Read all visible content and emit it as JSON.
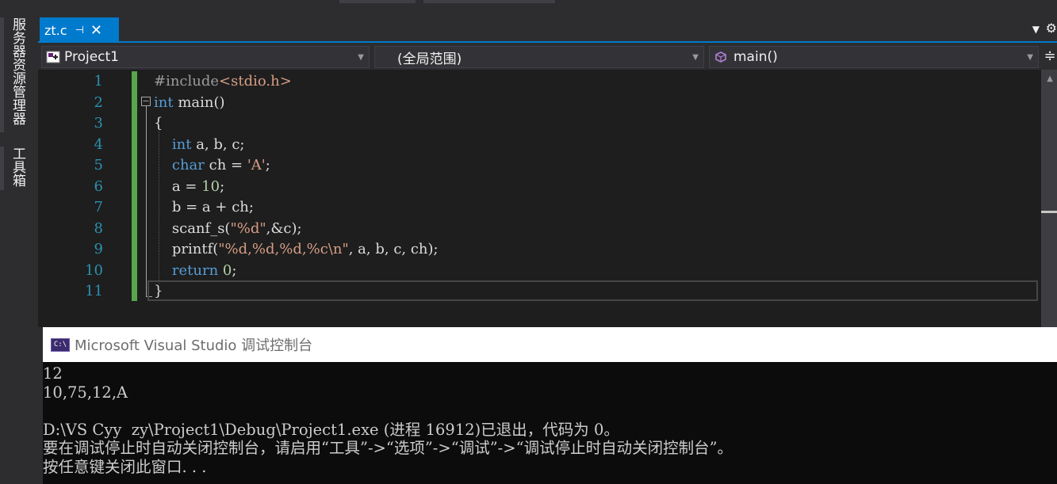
{
  "side_panel": {
    "tabs": [
      {
        "label": "服务器资源管理器"
      },
      {
        "label": "工具箱"
      }
    ]
  },
  "tabbar": {
    "active_tab": {
      "filename": "zt.c",
      "pin_icon": "pin-icon",
      "close_icon": "close-icon"
    },
    "dropdown_icon": "chevron-down-icon",
    "settings_icon": "gear-icon"
  },
  "navbar": {
    "project": "Project1",
    "scope": "(全局范围)",
    "member": "main()"
  },
  "editor": {
    "line_numbers": [
      "1",
      "2",
      "3",
      "4",
      "5",
      "6",
      "7",
      "8",
      "9",
      "10",
      "11"
    ],
    "lines": [
      [
        {
          "t": "#include",
          "c": "pp"
        },
        {
          "t": "<stdio.h>",
          "c": "inc"
        }
      ],
      [
        {
          "t": "int",
          "c": "kw"
        },
        {
          "t": " main()",
          "c": "plain"
        }
      ],
      [
        {
          "t": "{",
          "c": "plain"
        }
      ],
      [
        {
          "t": "    int",
          "c": "kw"
        },
        {
          "t": " a, b, c;",
          "c": "plain"
        }
      ],
      [
        {
          "t": "    char",
          "c": "kw"
        },
        {
          "t": " ch = ",
          "c": "plain"
        },
        {
          "t": "'A'",
          "c": "str"
        },
        {
          "t": ";",
          "c": "plain"
        }
      ],
      [
        {
          "t": "    a = ",
          "c": "plain"
        },
        {
          "t": "10",
          "c": "num"
        },
        {
          "t": ";",
          "c": "plain"
        }
      ],
      [
        {
          "t": "    b = a + ch;",
          "c": "plain"
        }
      ],
      [
        {
          "t": "    scanf_s(",
          "c": "plain"
        },
        {
          "t": "\"%d\"",
          "c": "str"
        },
        {
          "t": ",&c);",
          "c": "plain"
        }
      ],
      [
        {
          "t": "    printf(",
          "c": "plain"
        },
        {
          "t": "\"%d,%d,%d,%c\\n\"",
          "c": "str"
        },
        {
          "t": ", a, b, c, ch);",
          "c": "plain"
        }
      ],
      [
        {
          "t": "    return",
          "c": "kw"
        },
        {
          "t": " ",
          "c": "plain"
        },
        {
          "t": "0",
          "c": "num"
        },
        {
          "t": ";",
          "c": "plain"
        }
      ],
      [
        {
          "t": "}",
          "c": "plain"
        }
      ]
    ]
  },
  "console": {
    "title": "Microsoft Visual Studio 调试控制台",
    "icon_label": "C:\\",
    "output": [
      "12",
      "10,75,12,A",
      "",
      "D:\\VS Cyy  zy\\Project1\\Debug\\Project1.exe (进程 16912)已退出，代码为 0。",
      "要在调试停止时自动关闭控制台，请启用“工具”->“选项”->“调试”->“调试停止时自动关闭控制台”。",
      "按任意键关闭此窗口. . ."
    ]
  }
}
